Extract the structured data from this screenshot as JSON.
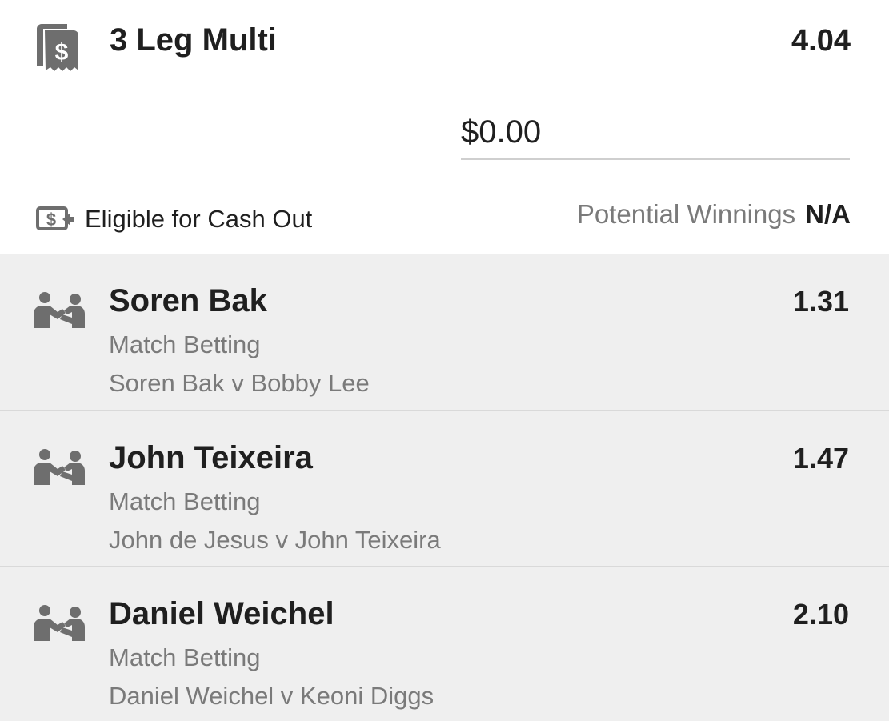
{
  "multi": {
    "icon": "receipt-dollar-icon",
    "title": "3 Leg Multi",
    "odds": "4.04",
    "stake_value": "$0.00",
    "cash_out_icon": "cash-out-icon",
    "cash_out_label": "Eligible for Cash Out",
    "potential_winnings_label": "Potential Winnings",
    "potential_winnings_value": "N/A"
  },
  "legs": [
    {
      "icon": "fighters-icon",
      "selection": "Soren Bak",
      "odds": "1.31",
      "market": "Match Betting",
      "event": "Soren Bak v Bobby Lee"
    },
    {
      "icon": "fighters-icon",
      "selection": "John Teixeira",
      "odds": "1.47",
      "market": "Match Betting",
      "event": "John de Jesus v John Teixeira"
    },
    {
      "icon": "fighters-icon",
      "selection": "Daniel Weichel",
      "odds": "2.10",
      "market": "Match Betting",
      "event": "Daniel Weichel v Keoni Diggs"
    }
  ]
}
